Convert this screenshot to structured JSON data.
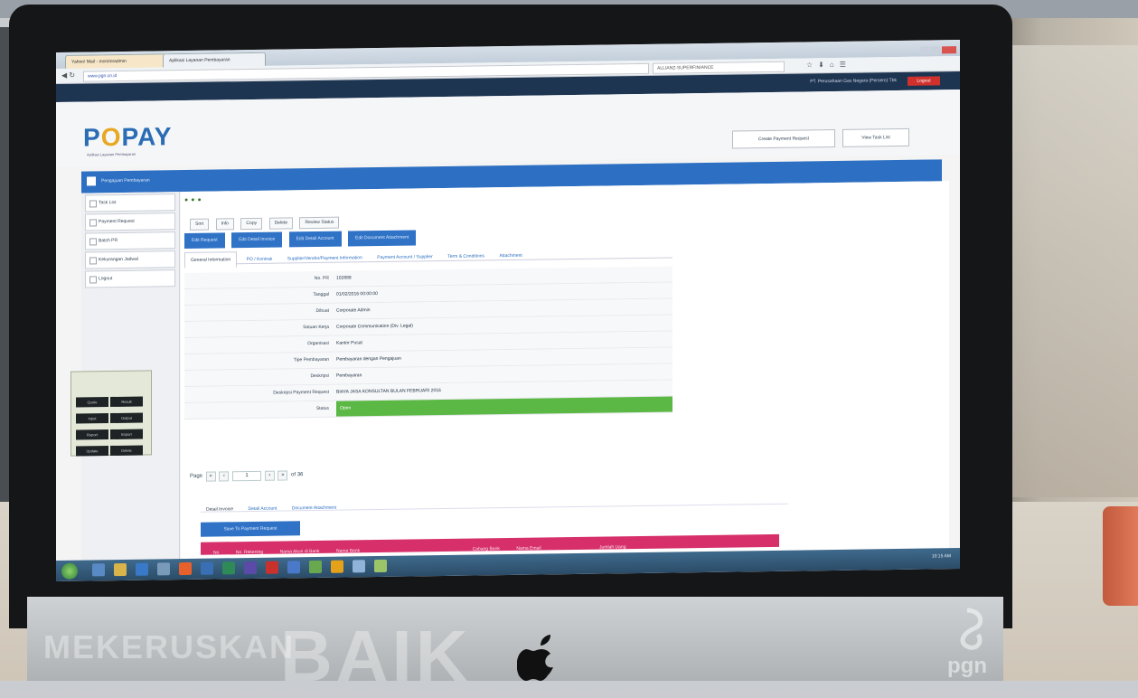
{
  "browser": {
    "tabs": [
      "Yahoo! Mail - monitoradmin",
      "Aplikasi Layanan Pembayaran"
    ],
    "url": "www.pgn.co.id",
    "search": "ALLIANZ-SUPERFINIANCE"
  },
  "topbar": {
    "user": "PT. Perusahaan Gas Negara (Persero) Tbk",
    "logout": "Logout"
  },
  "header": {
    "logo": "POPAY",
    "logo_sub": "Aplikasi Layanan Pembayaran",
    "btn_create": "Create Payment Request",
    "btn_tasklist": "View Task List"
  },
  "module": {
    "title": "Pengajuan Pembayaran"
  },
  "sidebar": {
    "items": [
      {
        "label": "Task List"
      },
      {
        "label": "Payment Request"
      },
      {
        "label": "Batch PR"
      },
      {
        "label": "Kekurangan Jadwal"
      },
      {
        "label": "Logout"
      }
    ]
  },
  "actions": [
    "Sort",
    "Info",
    "Copy",
    "Delete",
    "Review Status"
  ],
  "blue_buttons": [
    "Edit Request",
    "Edit Detail Invoice",
    "Edit Detail Account",
    "Edit Document Attachment"
  ],
  "subtabs": [
    "General Information",
    "PO / Kontrak",
    "Supplier/Vendor/Payment Information",
    "Payment Account / Supplier",
    "Term & Conditions",
    "Attachment"
  ],
  "form": [
    {
      "label": "No. PR",
      "value": "102888"
    },
    {
      "label": "Tanggal",
      "value": "01/02/2016 00:00:00"
    },
    {
      "label": "Dibuat",
      "value": "Corporate Admin"
    },
    {
      "label": "Satuan Kerja",
      "value": "Corporate Communication (Div. Legal)"
    },
    {
      "label": "Organisasi",
      "value": "Kantor Pusat"
    },
    {
      "label": "Tipe Pembayaran",
      "value": "Pembayaran dengan Pengajuan"
    },
    {
      "label": "Deskripsi",
      "value": "Pembayaran"
    },
    {
      "label": "Deskripsi Payment Request",
      "value": "BIAYA JASA KONSULTAN BULAN FEBRUARI 2016"
    },
    {
      "label": "Status",
      "value": "Open"
    }
  ],
  "pager": {
    "label": "Page",
    "current": "1",
    "of": "of 36"
  },
  "lowtabs": [
    "Detail Invoice",
    "Detail Account",
    "Document Attachment"
  ],
  "low_button": "Save To Payment Request",
  "table_headers": [
    "No",
    "No. Rekening",
    "Nama Akun di Bank",
    "Nama Bank",
    "Cabang Bank",
    "Nama Email",
    "Jumlah Uang"
  ],
  "taskbar": {
    "clock": "10:15 AM"
  },
  "mini_window": {
    "cells": [
      "Quote",
      "Result",
      "Input",
      "Output",
      "Report",
      "Export",
      "Update",
      "Delete"
    ]
  },
  "chin": {
    "text1": "MEKERUSKAN",
    "text2": "BAIK"
  }
}
